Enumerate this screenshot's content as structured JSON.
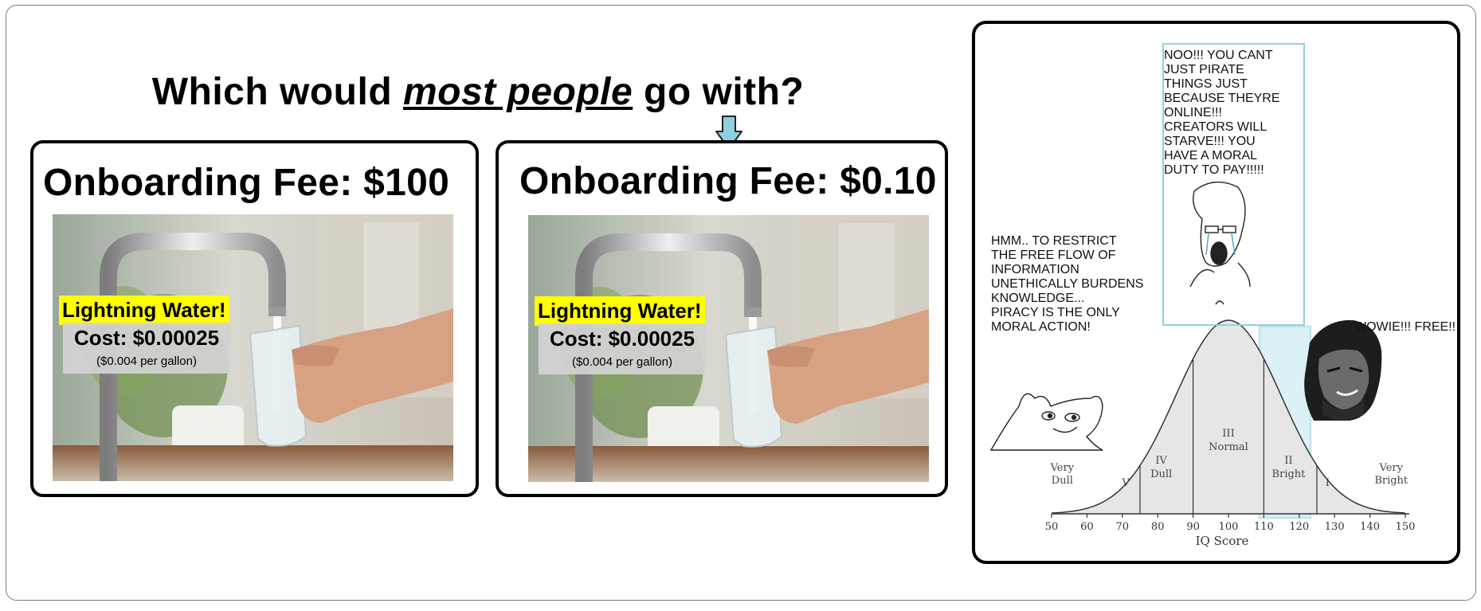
{
  "question": {
    "before": "Which would ",
    "emphasis": "most people",
    "after": " go with?"
  },
  "cards": [
    {
      "title": "Onboarding Fee: $100",
      "headline": "Lightning Water!",
      "cost": "Cost: $0.00025",
      "per_gallon": "($0.004 per gallon)"
    },
    {
      "title": "Onboarding Fee: $0.10",
      "headline": "Lightning Water!",
      "cost": "Cost: $0.00025",
      "per_gallon": "($0.004 per gallon)"
    }
  ],
  "colors": {
    "arrow": "#8fd0e0",
    "highlight": "#ffff00",
    "bell_highlight": "#8fd0e0"
  },
  "meme": {
    "top_text": "NOO!!! YOU CANT\nJUST PIRATE\nTHINGS JUST\nBECAUSE THEYRE\nONLINE!!!\nCREATORS WILL\nSTARVE!!! YOU\nHAVE A MORAL\nDUTY TO PAY!!!!!",
    "left_text": "HMM.. TO RESTRICT\nTHE FREE FLOW OF\nINFORMATION\nUNETHICALLY BURDENS\nKNOWLEDGE...\nPIRACY IS THE ONLY\nMORAL ACTION!",
    "right_text": "WOWIE!!! FREE!!",
    "bell_curve": {
      "xlabel": "IQ Score",
      "ticks": [
        "50",
        "60",
        "70",
        "80",
        "90",
        "100",
        "110",
        "120",
        "130",
        "140",
        "150"
      ],
      "zones": [
        {
          "roman": "",
          "label": "Very\nDull"
        },
        {
          "roman": "V",
          "label": ""
        },
        {
          "roman": "IV",
          "label": "Dull"
        },
        {
          "roman": "III",
          "label": "Normal"
        },
        {
          "roman": "II",
          "label": "Bright"
        },
        {
          "roman": "I",
          "label": ""
        },
        {
          "roman": "",
          "label": "Very\nBright"
        }
      ]
    },
    "icons": [
      "brainlet-face-icon",
      "crying-soyjak-face-icon",
      "chad-face-icon"
    ]
  }
}
